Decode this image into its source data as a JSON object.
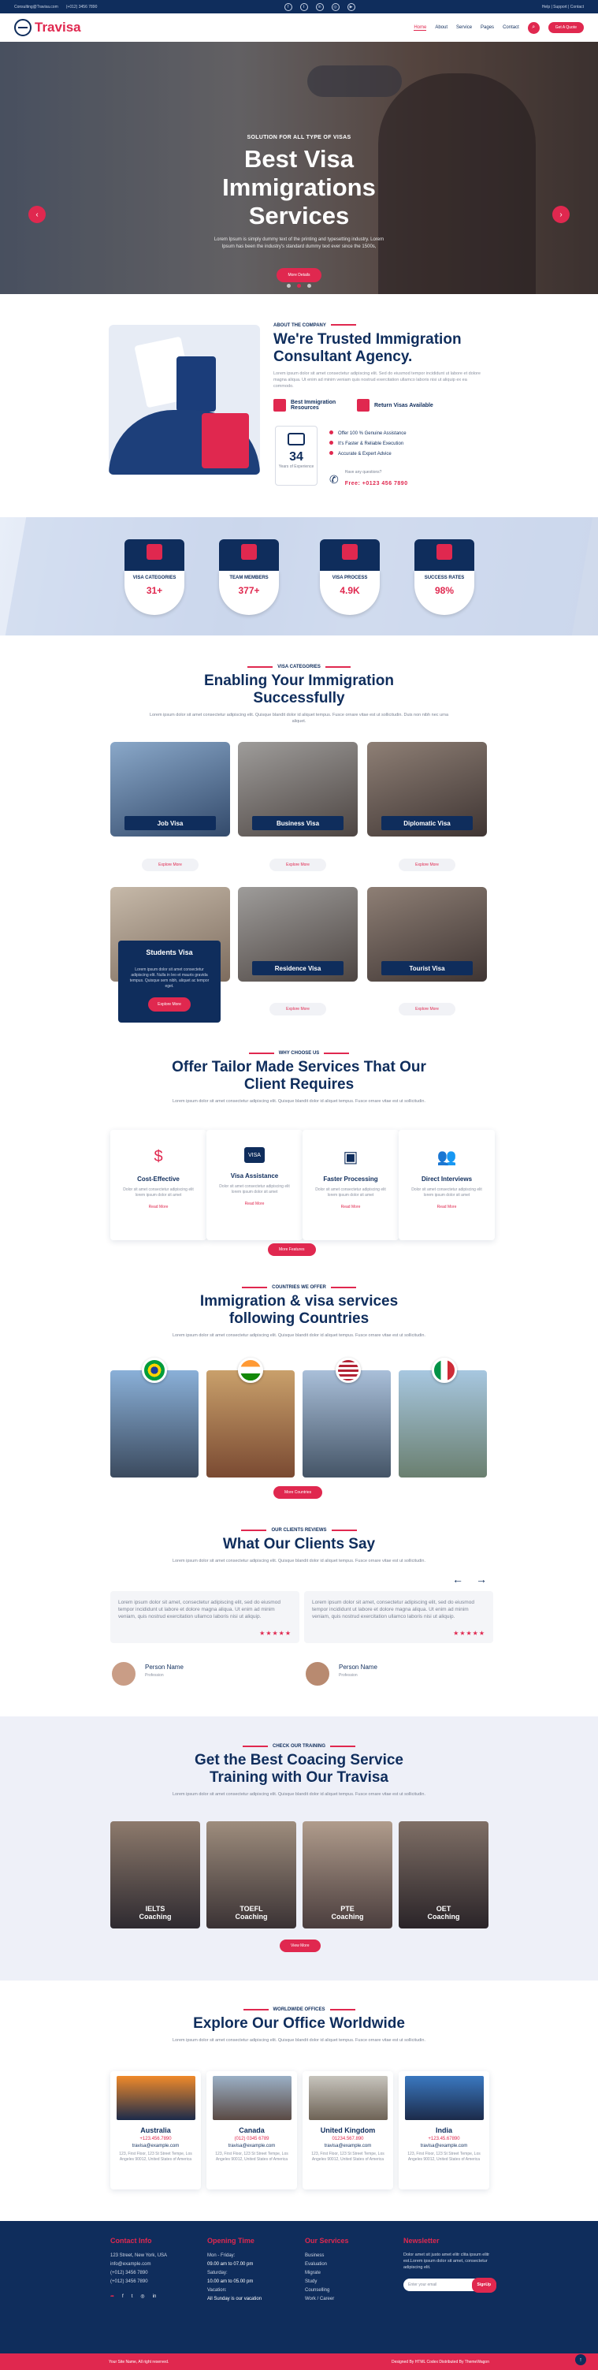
{
  "topbar": {
    "email": "Consulting@Travisa.com",
    "phone": "(+012) 3456 7890",
    "links": "Help | Support | Contact"
  },
  "header": {
    "logo": "Travisa",
    "nav": [
      "Home",
      "About",
      "Service",
      "Pages",
      "Contact"
    ],
    "cta": "Get A Quote"
  },
  "hero": {
    "kicker": "SOLUTION FOR ALL TYPE OF VISAS",
    "title_l1": "Best Visa",
    "title_l2": "Immigrations",
    "title_l3": "Services",
    "text": "Lorem Ipsum is simply dummy text of the printing and typesetting industry. Lorem Ipsum has been the industry's standard dummy text ever since the 1500s,",
    "button": "More Details"
  },
  "about": {
    "kicker": "ABOUT THE COMPANY",
    "title": "We're Trusted Immigration Consultant Agency.",
    "text": "Lorem ipsum dolor sit amet consectetur adipiscing elit. Sed do eiusmod tempor incididunt ut labore et dolore magna aliqua. Ut enim ad minim veniam quis nostrud exercitation ullamco laboris nisi ut aliquip ex ea commodo.",
    "feature1": "Best Immigration Resources",
    "feature2": "Return Visas Available",
    "exp_num": "34",
    "exp_label": "Years of Experience",
    "checks": [
      "Offer 100 % Genuine Assistance",
      "It's Faster & Reliable Execution",
      "Accurate & Expert Advice"
    ],
    "call_q": "Have any questions?",
    "call_num": "Free: +0123 456 7890"
  },
  "stats": [
    {
      "label": "VISA CATEGORIES",
      "value": "31+"
    },
    {
      "label": "TEAM MEMBERS",
      "value": "377+"
    },
    {
      "label": "VISA PROCESS",
      "value": "4.9K"
    },
    {
      "label": "SUCCESS RATES",
      "value": "98%"
    }
  ],
  "categories": {
    "kicker": "VISA CATEGORIES",
    "title_l1": "Enabling Your Immigration",
    "title_l2": "Successfully",
    "text": "Lorem ipsum dolor sit amet consectetur adipiscing elit. Quisque blandit dolor id aliquet tempus. Fusce ornare vitae est ut sollicitudin. Duis non nibh nec urna aliquet.",
    "items": [
      "Job Visa",
      "Business Visa",
      "Diplomatic Visa",
      "Students Visa",
      "Residence Visa",
      "Tourist Visa"
    ],
    "explore": "Explore More",
    "student_text": "Lorem ipsum dolor sit amet consectetur adipiscing elit. Nulla in leo et mauris gravida tempus. Quisque sem nibh, aliquet ac tempor eget."
  },
  "why": {
    "kicker": "WHY CHOOSE US",
    "title_l1": "Offer Tailor Made Services That Our",
    "title_l2": "Client Requires",
    "text": "Lorem ipsum dolor sit amet consectetur adipiscing elit. Quisque blandit dolor id aliquet tempus. Fusce ornare vitae est ut sollicitudin.",
    "items": [
      {
        "title": "Cost-Effective",
        "text": "Dolor sit amet consectetur adipiscing elit lorem ipsum dolor sit amet"
      },
      {
        "title": "Visa Assistance",
        "text": "Dolor sit amet consectetur adipiscing elit lorem ipsum dolor sit amet"
      },
      {
        "title": "Faster Processing",
        "text": "Dolor sit amet consectetur adipiscing elit lorem ipsum dolor sit amet"
      },
      {
        "title": "Direct Interviews",
        "text": "Dolor sit amet consectetur adipiscing elit lorem ipsum dolor sit amet"
      }
    ],
    "read": "Read More",
    "button": "More Features"
  },
  "countries": {
    "kicker": "COUNTRIES WE OFFER",
    "title_l1": "Immigration & visa services",
    "title_l2": "following Countries",
    "text": "Lorem ipsum dolor sit amet consectetur adipiscing elit. Quisque blandit dolor id aliquet tempus. Fusce ornare vitae est ut sollicitudin.",
    "button": "More Countries"
  },
  "reviews": {
    "kicker": "OUR CLIENTS REVIEWS",
    "title": "What Our Clients Say",
    "text": "Lorem ipsum dolor sit amet consectetur adipiscing elit. Quisque blandit dolor id aliquet tempus. Fusce ornare vitae est ut sollicitudin.",
    "quote": "Lorem ipsum dolor sit amet, consectetur adipiscing elit, sed do eiusmod tempor incididunt ut labore et dolore magna aliqua. Ut enim ad minim veniam, quis nostrud exercitation ullamco laboris nisi ut aliquip.",
    "person": "Person Name",
    "role": "Profession",
    "stars": "★★★★★"
  },
  "training": {
    "kicker": "CHECK OUR TRAINING",
    "title_l1": "Get the Best Coacing Service",
    "title_l2": "Training with Our Travisa",
    "text": "Lorem ipsum dolor sit amet consectetur adipiscing elit. Quisque blandit dolor id aliquet tempus. Fusce ornare vitae est ut sollicitudin.",
    "items": [
      [
        "IELTS",
        "Coaching"
      ],
      [
        "TOEFL",
        "Coaching"
      ],
      [
        "PTE",
        "Coaching"
      ],
      [
        "OET",
        "Coaching"
      ]
    ],
    "button": "View More"
  },
  "offices": {
    "kicker": "WORLDWIDE OFFICES",
    "title": "Explore Our Office Worldwide",
    "text": "Lorem ipsum dolor sit amet consectetur adipiscing elit. Quisque blandit dolor id aliquet tempus. Fusce ornare vitae est ut sollicitudin.",
    "items": [
      {
        "name": "Australia",
        "phone": "+123.456.7890",
        "email": "travisa@example.com",
        "addr": "123, First Floor, 123 St Street Tempe, Los Angeles 90012, United States of America"
      },
      {
        "name": "Canada",
        "phone": "(012) 0345 6789",
        "email": "travisa@example.com",
        "addr": "123, First Floor, 123 St Street Tempe, Los Angeles 90012, United States of America"
      },
      {
        "name": "United Kingdom",
        "phone": "01234.567.890",
        "email": "travisa@example.com",
        "addr": "123, First Floor, 123 St Street Tempe, Los Angeles 90012, United States of America"
      },
      {
        "name": "India",
        "phone": "+123.45.67890",
        "email": "travisa@example.com",
        "addr": "123, First Floor, 123 St Street Tempe, Los Angeles 90012, United States of America"
      }
    ]
  },
  "footer": {
    "contact_title": "Contact Info",
    "contact": [
      "123 Street, New York, USA",
      "info@example.com",
      "(+012) 3456 7890",
      "(+012) 3456 7890"
    ],
    "hours_title": "Opening Time",
    "hours": [
      "Mon - Friday:",
      "09.00 am to 07.00 pm",
      "Saturday:",
      "10.00 am to 05.00 pm",
      "Vacation:",
      "All Sunday is our vacation"
    ],
    "services_title": "Our Services",
    "services": [
      "Business",
      "Evaluation",
      "Migrate",
      "Study",
      "Counselling",
      "Work / Career"
    ],
    "news_title": "Newsletter",
    "news_text": "Dolor amet sit justo amet elitr clita ipsum elitr est.Lorem ipsum dolor sit amet, consectetur adipiscing elit.",
    "news_placeholder": "Enter your email",
    "news_button": "SignUp"
  },
  "copyright": {
    "left": "Your Site Name, All right reserved.",
    "right": "Designed By HTML Codex Distributed By ThemeWagon"
  },
  "colors": {
    "navy": "#0f2d5c",
    "accent": "#e0284f"
  }
}
